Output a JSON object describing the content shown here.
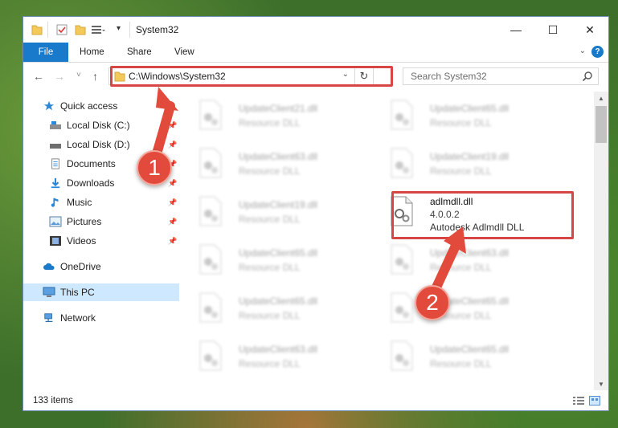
{
  "window": {
    "title": "System32",
    "controls": {
      "minimize": "—",
      "maximize": "☐",
      "close": "✕"
    }
  },
  "ribbon": {
    "tabs": [
      {
        "label": "File"
      },
      {
        "label": "Home"
      },
      {
        "label": "Share"
      },
      {
        "label": "View"
      }
    ],
    "help": "?",
    "accent": "#1979ca"
  },
  "navigation": {
    "back": "←",
    "forward": "→",
    "recent": "˅",
    "up": "↑",
    "address": "C:\\Windows\\System32",
    "search_placeholder": "Search System32"
  },
  "sidebar": {
    "items": [
      {
        "label": "Quick access",
        "icon": "star-icon"
      },
      {
        "label": "Local Disk (C:)",
        "icon": "drive-icon",
        "pinned": true
      },
      {
        "label": "Local Disk (D:)",
        "icon": "drive-icon",
        "pinned": true
      },
      {
        "label": "Documents",
        "icon": "document-icon",
        "pinned": true
      },
      {
        "label": "Downloads",
        "icon": "download-icon",
        "pinned": true
      },
      {
        "label": "Music",
        "icon": "music-icon",
        "pinned": true
      },
      {
        "label": "Pictures",
        "icon": "pictures-icon",
        "pinned": true
      },
      {
        "label": "Videos",
        "icon": "video-icon",
        "pinned": true
      },
      {
        "label": "OneDrive",
        "icon": "cloud-icon"
      },
      {
        "label": "This PC",
        "icon": "computer-icon",
        "selected": true
      },
      {
        "label": "Network",
        "icon": "network-icon"
      }
    ]
  },
  "files": {
    "left": [
      {
        "name": "UpdateClient21.dll",
        "desc": "Resource DLL"
      },
      {
        "name": "UpdateClient63.dll",
        "desc": "Resource DLL"
      },
      {
        "name": "UpdateClient19.dll",
        "desc": "Resource DLL"
      },
      {
        "name": "UpdateClient65.dll",
        "desc": "Resource DLL"
      },
      {
        "name": "UpdateClient65.dll",
        "desc": "Resource DLL"
      },
      {
        "name": "UpdateClient63.dll",
        "desc": "Resource DLL"
      }
    ],
    "right": [
      {
        "name": "UpdateClient65.dll",
        "desc": "Resource DLL"
      },
      {
        "name": "UpdateClient19.dll",
        "desc": "Resource DLL"
      },
      {
        "name": "UpdateClient63.dll",
        "desc": "Resource DLL"
      },
      {
        "name": "UpdateClient65.dll",
        "desc": "Resource DLL"
      },
      {
        "name": "UpdateClient65.dll",
        "desc": "Resource DLL"
      }
    ],
    "highlighted": {
      "name": "adlmdll.dll",
      "version": "4.0.0.2",
      "desc": "Autodesk Adlmdll DLL"
    }
  },
  "status": {
    "item_count": "133 items"
  },
  "annotations": {
    "step1": "1",
    "step2": "2",
    "color": "#e24a3c"
  }
}
